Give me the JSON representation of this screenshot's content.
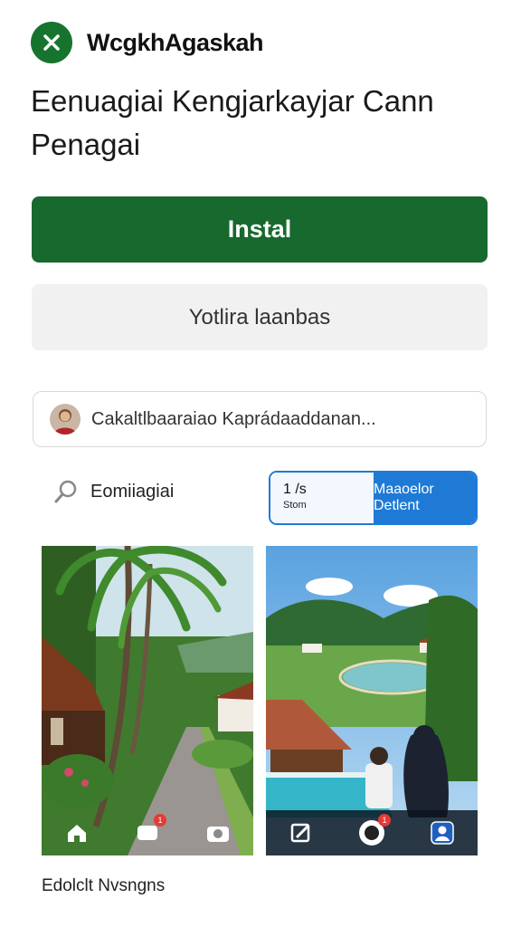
{
  "header": {
    "app_name": "WcgkhAgaskah",
    "close_icon": "close-icon"
  },
  "headline": "Eenuagiai Kengjarkayjar Cann Penagai",
  "buttons": {
    "install": "Instal",
    "secondary": "Yotlira laanbas"
  },
  "comment": {
    "placeholder": "Cakaltlbaaraiao Kaprádaaddanan..."
  },
  "search": {
    "label": "Eomiiagiai"
  },
  "toggle": {
    "count": "1 /s",
    "sub": "Stom",
    "action": "Maaoelor Detlent"
  },
  "cards": [
    {
      "scene": "palm-village-path",
      "icons": [
        "home-icon",
        "chat-icon",
        "camera-icon"
      ],
      "badge": "1"
    },
    {
      "scene": "resort-pool-hills",
      "icons": [
        "edit-icon",
        "record-icon",
        "profile-icon"
      ],
      "badge": "1"
    }
  ],
  "footer": {
    "text": "Edolclt Nvsngns"
  },
  "colors": {
    "primary_green": "#16742f",
    "accent_blue": "#1f7ad6",
    "secondary_bg": "#f1f1f1",
    "badge_red": "#e53935"
  }
}
